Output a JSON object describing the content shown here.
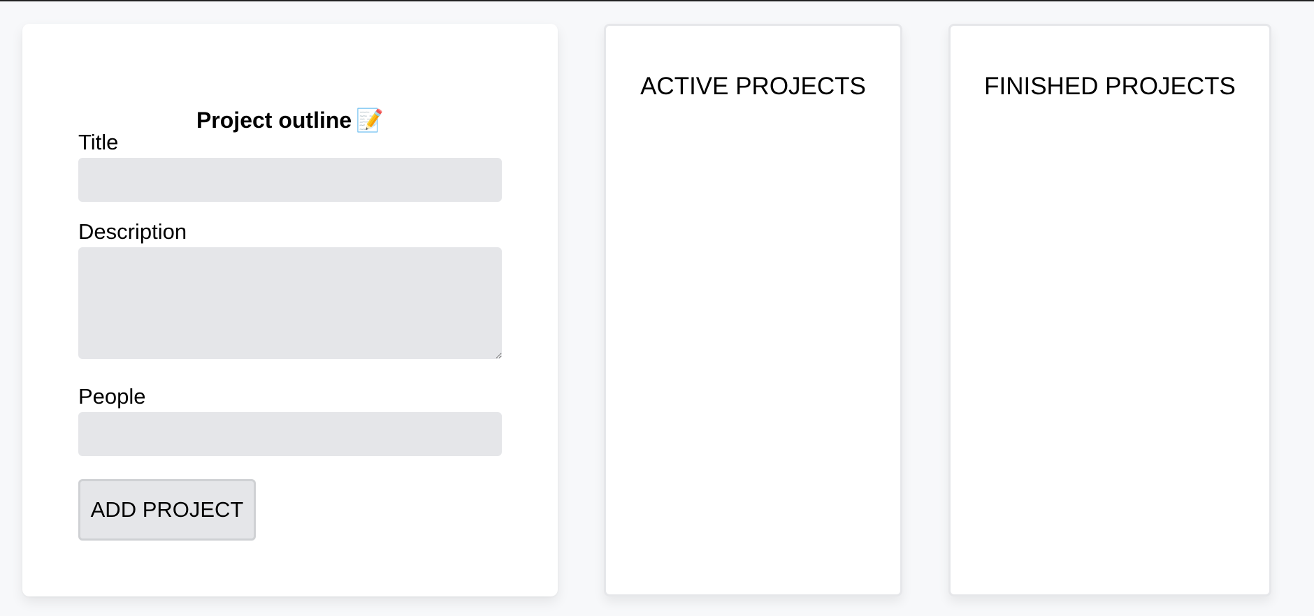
{
  "form": {
    "title": "Project outline",
    "title_icon": "📝",
    "fields": {
      "title": {
        "label": "Title",
        "value": "",
        "placeholder": ""
      },
      "description": {
        "label": "Description",
        "value": "",
        "placeholder": ""
      },
      "people": {
        "label": "People",
        "value": "",
        "placeholder": ""
      }
    },
    "submit_label": "ADD PROJECT"
  },
  "lists": {
    "active": {
      "title": "ACTIVE PROJECTS",
      "items": []
    },
    "finished": {
      "title": "FINISHED PROJECTS",
      "items": []
    }
  },
  "colors": {
    "page_background": "#f7f8fa",
    "card_background": "#ffffff",
    "input_background": "#e5e6e9",
    "button_border": "#cfd1d4",
    "list_border": "#e6e7ea"
  }
}
